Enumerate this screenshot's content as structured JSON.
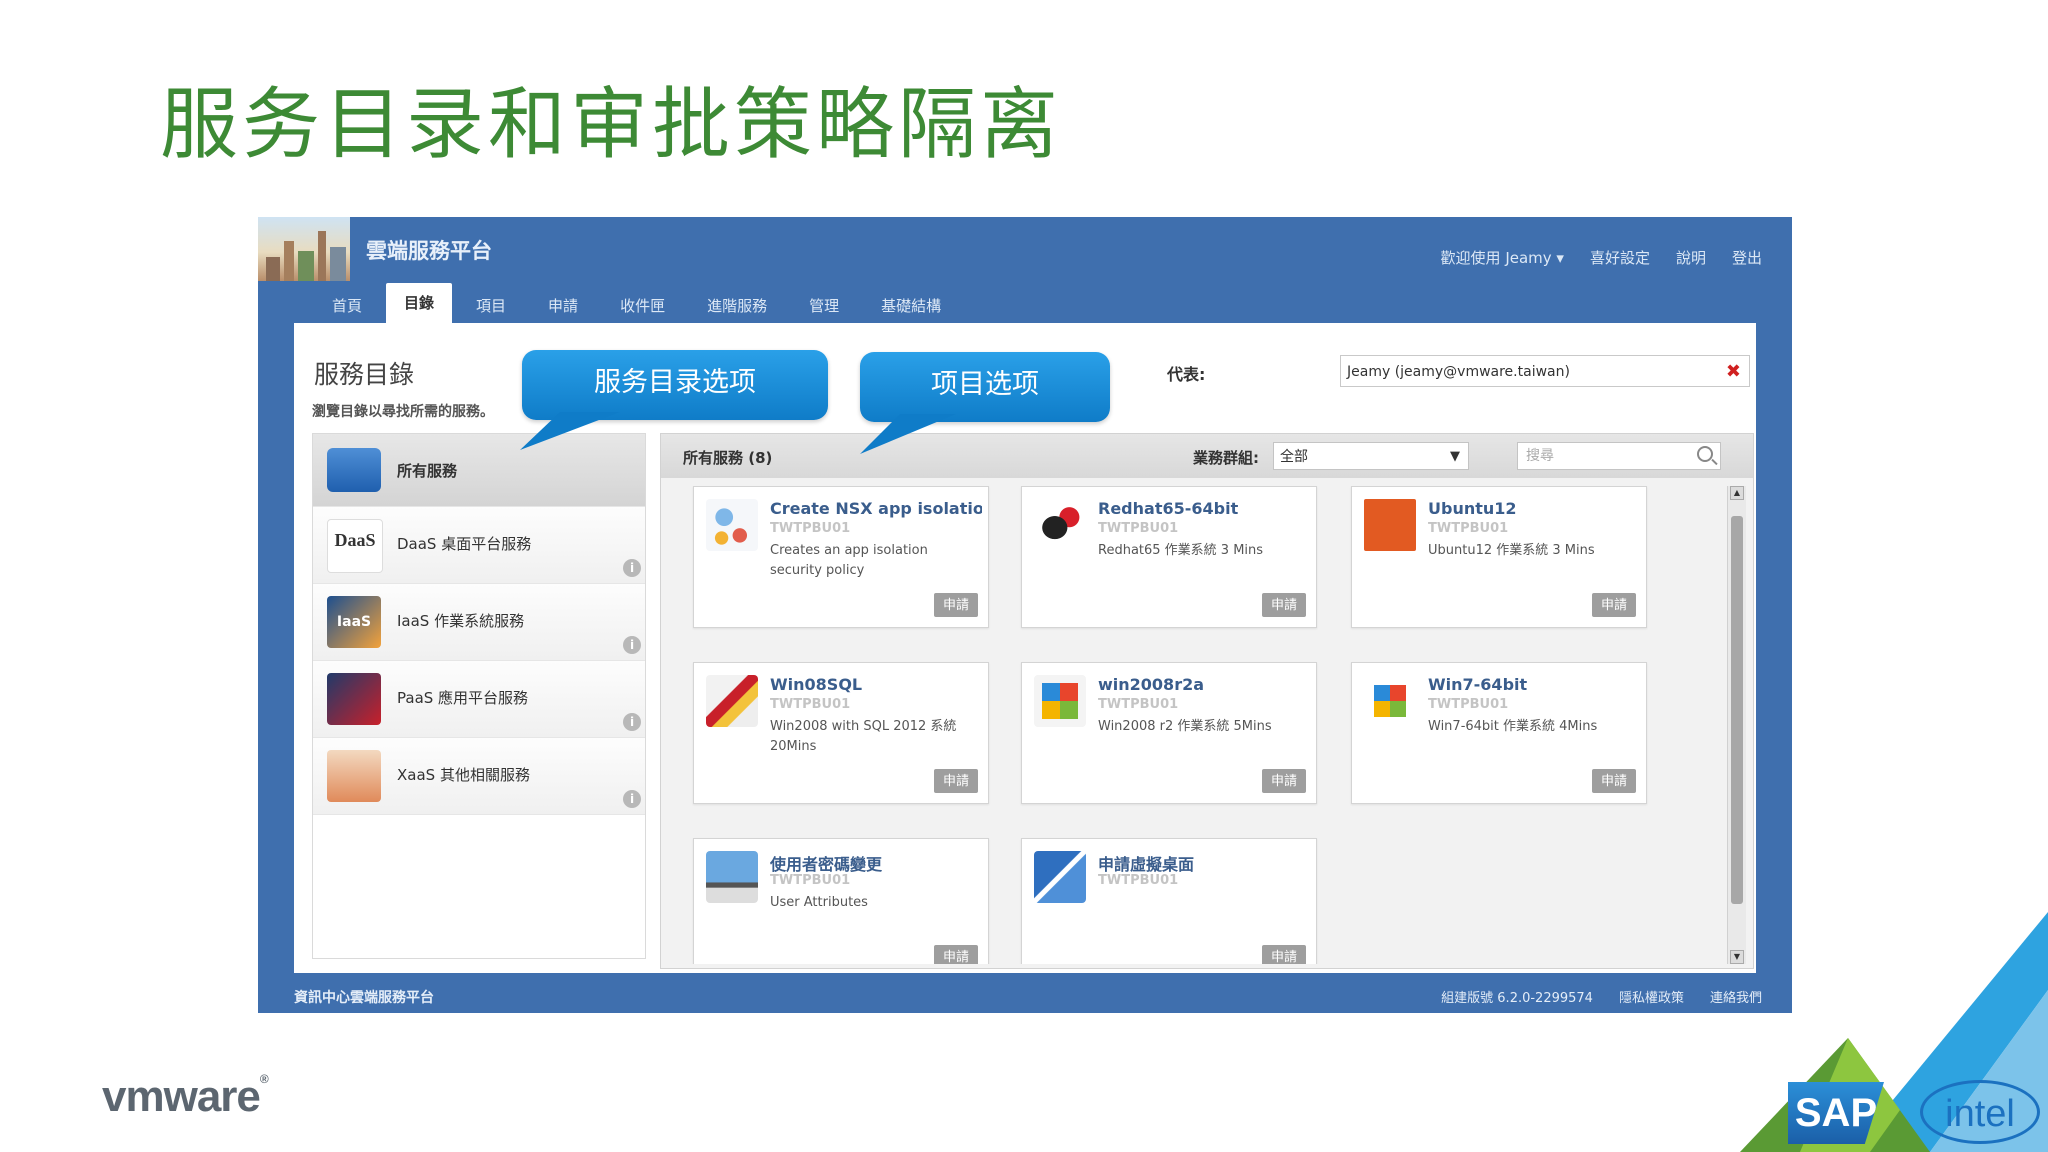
{
  "slide": {
    "title": "服务目录和审批策略隔离",
    "callouts": [
      "服务目录选项",
      "项目选项"
    ],
    "vmware_logo": "vmware",
    "sap_logo": "SAP",
    "intel_logo": "intel"
  },
  "app": {
    "name": "雲端服務平台",
    "top_links": [
      "歡迎使用 Jeamy ▾",
      "喜好設定",
      "說明",
      "登出"
    ],
    "tabs": [
      "首頁",
      "目錄",
      "項目",
      "申請",
      "收件匣",
      "進階服務",
      "管理",
      "基礎結構"
    ],
    "active_tab": "目錄",
    "catalog_heading": "服務目錄",
    "catalog_subtitle": "瀏覽目錄以尋找所需的服務。",
    "representing_label": "代表:",
    "representing_value": "Jeamy (jeamy@vmware.taiwan)",
    "sidebar": [
      {
        "label": "所有服務",
        "active": true,
        "icon": "lego-block-icon"
      },
      {
        "label": "DaaS 桌面平台服務",
        "active": false,
        "icon": "daas-icon"
      },
      {
        "label": "IaaS 作業系統服務",
        "active": false,
        "icon": "iaas-icon"
      },
      {
        "label": "PaaS 應用平台服務",
        "active": false,
        "icon": "paas-icon"
      },
      {
        "label": "XaaS 其他相關服務",
        "active": false,
        "icon": "xaas-icon"
      }
    ],
    "panel": {
      "title": "所有服務 (8)",
      "group_label": "業務群組:",
      "group_value": "全部",
      "search_placeholder": "搜尋"
    },
    "cards": [
      {
        "title": "Create NSX app isolatio...",
        "org": "TWTPBU01",
        "desc": "Creates an app isolation security policy",
        "icon": "network-policy-icon"
      },
      {
        "title": "Redhat65-64bit",
        "org": "TWTPBU01",
        "desc": "Redhat65 作業系統 3 Mins",
        "icon": "redhat-icon"
      },
      {
        "title": "Ubuntu12",
        "org": "TWTPBU01",
        "desc": "Ubuntu12 作業系統 3 Mins",
        "icon": "ubuntu-icon"
      },
      {
        "title": "Win08SQL",
        "org": "TWTPBU01",
        "desc": "Win2008 with SQL 2012 系統 20Mins",
        "icon": "sql-server-icon"
      },
      {
        "title": "win2008r2a",
        "org": "TWTPBU01",
        "desc": "Win2008 r2 作業系統 5Mins",
        "icon": "windows-server-icon"
      },
      {
        "title": "Win7-64bit",
        "org": "TWTPBU01",
        "desc": "Win7-64bit 作業系統 4Mins",
        "icon": "windows7-icon"
      },
      {
        "title": "使用者密碼變更",
        "org": "TWTPBU01",
        "desc": "User Attributes",
        "icon": "user-computer-icon"
      },
      {
        "title": "申請虛擬桌面",
        "org": "TWTPBU01",
        "desc": "",
        "icon": "virtual-desktop-icon"
      }
    ],
    "request_label": "申請",
    "footer_left": "資訊中心雲端服務平台",
    "footer_right": [
      "組建版號 6.2.0-2299574",
      "隱私權政策",
      "連絡我們"
    ]
  }
}
